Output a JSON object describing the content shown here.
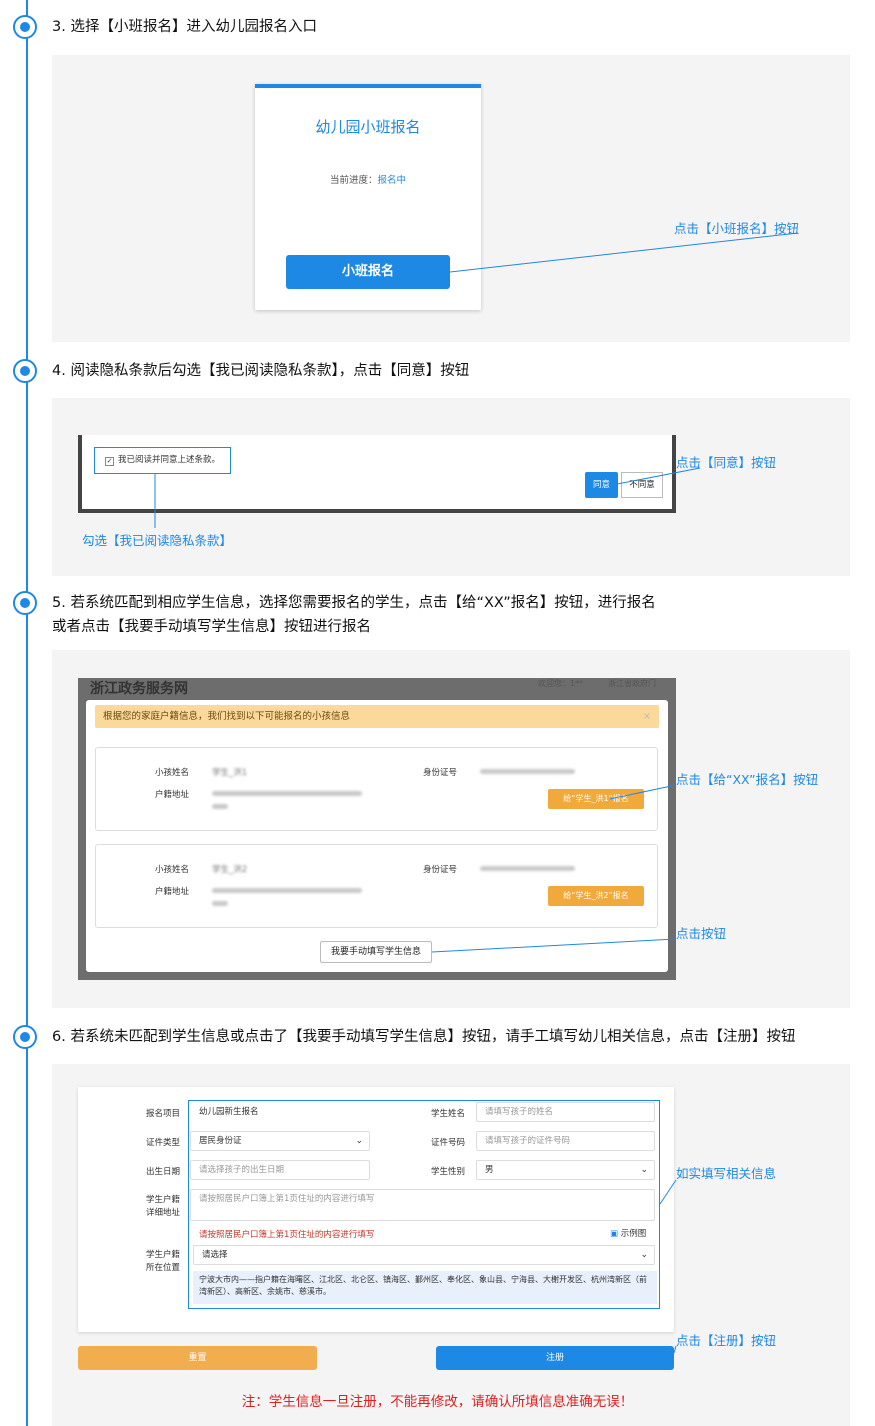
{
  "steps": {
    "s3": {
      "title": "3. 选择【小班报名】进入幼儿园报名入口",
      "card_title": "幼儿园小班报名",
      "progress_label": "当前进度：",
      "progress_value": "报名中",
      "button": "小班报名",
      "callout": "点击【小班报名】按钮"
    },
    "s4": {
      "title": "4. 阅读隐私条款后勾选【我已阅读隐私条款】，点击【同意】按钮",
      "checkbox_label": "我已阅读并同意上述条款。",
      "agree": "同意",
      "disagree": "不同意",
      "callout_agree": "点击【同意】按钮",
      "callout_check": "勾选【我已阅读隐私条款】"
    },
    "s5": {
      "title_line1": "5. 若系统匹配到相应学生信息，选择您需要报名的学生，点击【给“XX”报名】按钮，进行报名",
      "title_line2": "或者点击【我要手动填写学生信息】按钮进行报名",
      "bg_header": "浙江政务服务网",
      "bg_welcome": "欢迎您：1**",
      "bg_portal": "浙江省政府门",
      "notice": "根据您的家庭户籍信息，我们找到以下可能报名的小孩信息",
      "close": "×",
      "name_label": "小孩姓名",
      "addr_label": "户籍地址",
      "id_label": "身份证号",
      "kid1_name": "学生_洪1",
      "kid2_name": "学生_洪2",
      "signup_btn": "给“学生_洪1”报名",
      "signup_btn2": "给“学生_洪2”报名",
      "manual_btn": "我要手动填写学生信息",
      "callout_signup": "点击【给“XX”报名】按钮",
      "callout_manual": "点击按钮"
    },
    "s6": {
      "title": "6. 若系统未匹配到学生信息或点击了【我要手动填写学生信息】按钮，请手工填写幼儿相关信息，点击【注册】按钮",
      "project_label": "报名项目",
      "project_value": "幼儿园新生报名",
      "name_label": "学生姓名",
      "name_ph": "请填写孩子的姓名",
      "idtype_label": "证件类型",
      "idtype_value": "居民身份证",
      "idno_label": "证件号码",
      "idno_ph": "请填写孩子的证件号码",
      "dob_label": "出生日期",
      "dob_ph": "请选择孩子的出生日期",
      "gender_label": "学生性别",
      "gender_value": "男",
      "hukou_label1": "学生户籍",
      "hukou_label2": "详细地址",
      "hukou_ph": "请按照居民户口簿上第1页住址的内容进行填写",
      "hukou_hint": "请按照居民户口簿上第1页住址的内容进行填写",
      "example": "示例图",
      "loc_label1": "学生户籍",
      "loc_label2": "所在位置",
      "loc_value": "请选择",
      "loc_note": "宁波大市内——指户籍在海曙区、江北区、北仑区、镇海区、鄞州区、奉化区、象山县、宁海县、大榭开发区、杭州湾新区（前湾新区）、高新区、余姚市、慈溪市。",
      "reset": "重置",
      "register": "注册",
      "callout_fill": "如实填写相关信息",
      "callout_register": "点击【注册】按钮",
      "warning": "注：学生信息一旦注册，不能再修改，请确认所填信息准确无误！"
    }
  }
}
